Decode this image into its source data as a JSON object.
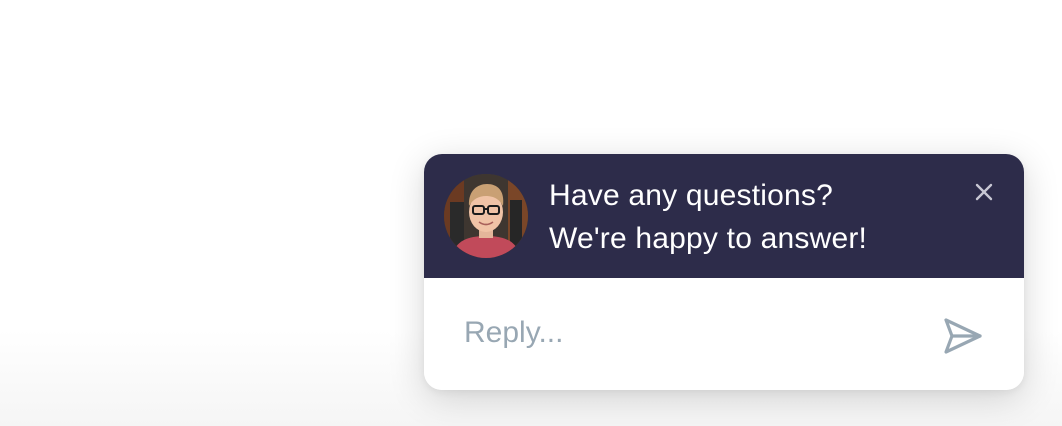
{
  "chat_widget": {
    "avatar_icon": "user-avatar-photo",
    "message_line_1": "Have any questions?",
    "message_line_2": "We're happy to answer!",
    "close_icon": "close-icon",
    "reply_placeholder": "Reply...",
    "reply_value": "",
    "send_icon": "send-icon",
    "colors": {
      "header_bg": "#2d2c4a",
      "header_text": "#ffffff",
      "placeholder": "#98a7b3",
      "send_icon": "#98a7b3",
      "close_icon": "#c8c8d4"
    }
  }
}
